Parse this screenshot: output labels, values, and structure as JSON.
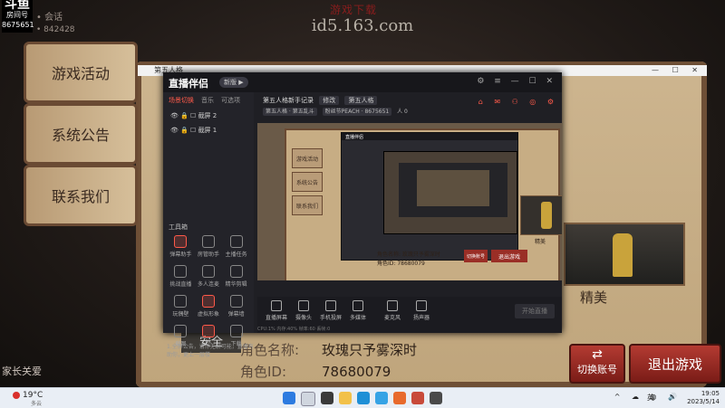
{
  "overlay": {
    "site_watermark": "游戏下载",
    "site_url": "id5.163.com",
    "streamer_tag_top": "斗鱼",
    "streamer_tag_mid": "房间号",
    "streamer_tag_id": "8675651",
    "blur_line_1": "• 会话",
    "blur_line_2": "• 842428"
  },
  "game": {
    "tabs": [
      "游戏活动",
      "系统公告",
      "联系我们"
    ],
    "safety_label": "安全",
    "parent_label": "家长关爱",
    "role_name_label": "角色名称:",
    "role_name_value": "玫瑰只予雾深时",
    "role_id_label": "角色ID:",
    "role_id_value": "78680079",
    "fine_label": "精美",
    "switch_account": "切换账号",
    "exit_game": "退出游戏"
  },
  "window": {
    "title": "第五人格",
    "controls": "— ☐ ✕"
  },
  "obs": {
    "logo": "直播伴侣",
    "version": "新版 ▶",
    "top_controls": "⚙ ≡ — ☐ ✕",
    "side_tabs": [
      "场景切换",
      "音乐",
      "可选项"
    ],
    "scenes": [
      "截屏 2",
      "截屏 1"
    ],
    "stream_title": "第五人格新手记录",
    "stream_title_edit": "修改",
    "stream_category": "第五人格",
    "stream_tag_1": "第五人格 · 第五乱斗",
    "stream_tag_2": "粉丝节PEACH · 8675651",
    "stream_tag_3": "人 0",
    "right_icons": "⌂ ✉ ⚇ ◎ ⚙",
    "toolbox_title": "工具箱",
    "tools": [
      "弹幕助手",
      "房管助手",
      "主播任务",
      "挑战直播",
      "多人连麦",
      "精华剪辑",
      "玩偶壁",
      "虚拟形象",
      "弹幕墙",
      "截图",
      "PK",
      "下载"
    ],
    "foot_note": "1.全屏公告，请你无聊可能，直播有助你，更上一层楼",
    "bottom_buttons": [
      "直播屏幕",
      "摄像头",
      "手机投屏",
      "多媒体",
      "麦克风",
      "扬声器"
    ],
    "go_live": "开始直播",
    "status": "CPU:1% 内存:40%  帧率:60  丢帧:0"
  },
  "preview": {
    "tabs": [
      "游戏活动",
      "系统公告",
      "联系我们"
    ],
    "logo": "直播伴侣",
    "role_line_1": "角色名称:  玫瑰只予雾深时",
    "role_line_2": "角色ID:  78680079",
    "switch": "切换账号",
    "exit": "退出游戏",
    "fine": "精美"
  },
  "taskbar": {
    "weather": "19°C",
    "weather_sub": "多云",
    "tray": "^ ☁ ◍ 🔊",
    "lang": "英",
    "time": "19:05",
    "date": "2023/5/14"
  }
}
